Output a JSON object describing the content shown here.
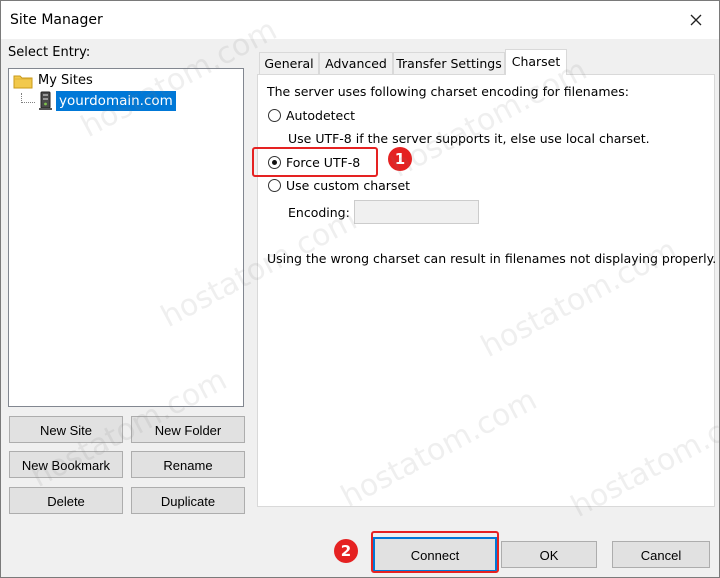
{
  "window": {
    "title": "Site Manager"
  },
  "left": {
    "select_label": "Select Entry:",
    "tree": {
      "root_label": "My Sites",
      "sites": [
        "yourdomain.com"
      ]
    },
    "buttons": {
      "new_site": "New Site",
      "new_folder": "New Folder",
      "new_bookmark": "New Bookmark",
      "rename": "Rename",
      "delete": "Delete",
      "duplicate": "Duplicate"
    }
  },
  "tabs": [
    {
      "label": "General",
      "active": false
    },
    {
      "label": "Advanced",
      "active": false
    },
    {
      "label": "Transfer Settings",
      "active": false
    },
    {
      "label": "Charset",
      "active": true
    }
  ],
  "charset": {
    "intro": "The server uses following charset encoding for filenames:",
    "options": {
      "autodetect": "Autodetect",
      "autodetect_desc": "Use UTF-8 if the server supports it, else use local charset.",
      "force_utf8": "Force UTF-8",
      "custom": "Use custom charset"
    },
    "selected": "force_utf8",
    "encoding_label": "Encoding:",
    "encoding_value": "",
    "warning": "Using the wrong charset can result in filenames not displaying properly."
  },
  "footer": {
    "connect": "Connect",
    "ok": "OK",
    "cancel": "Cancel"
  },
  "annotations": {
    "marker_1": "1",
    "marker_2": "2",
    "color": "#e52222"
  },
  "watermark": "hostatom.com",
  "icons": {
    "folder": "folder-icon",
    "server": "server-icon",
    "close": "close-icon"
  }
}
